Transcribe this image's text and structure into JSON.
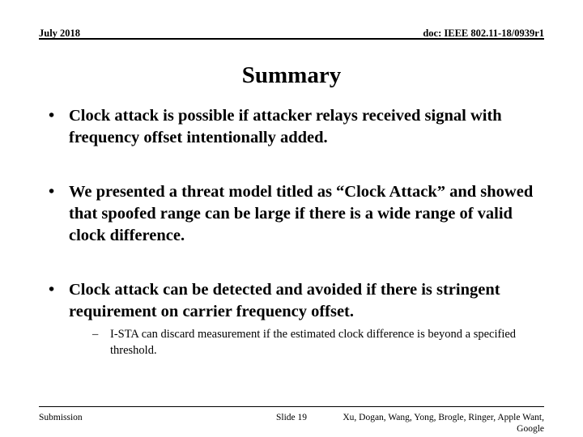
{
  "header": {
    "date": "July 2018",
    "doc": "doc: IEEE 802.11-18/0939r1"
  },
  "title": "Summary",
  "body": {
    "bullet_marker": "•",
    "sub_marker": "–",
    "bullets": [
      {
        "text": "Clock attack is possible if attacker relays received signal with frequency offset intentionally added."
      },
      {
        "text": "We presented a threat model titled as “Clock Attack” and showed that spoofed range can be large if there is a wide range of valid clock difference."
      },
      {
        "text": "Clock attack can be detected and avoided if there is stringent requirement on carrier frequency offset."
      }
    ],
    "subbullets": [
      {
        "text": "I-STA can discard measurement if the estimated clock difference is beyond a specified threshold."
      }
    ]
  },
  "footer": {
    "left": "Submission",
    "center": "Slide 19",
    "right": "Xu, Dogan, Wang, Yong, Brogle, Ringer, Apple Want, Google"
  },
  "colors": {
    "text": "#000000",
    "background": "#ffffff",
    "rule": "#000000"
  }
}
